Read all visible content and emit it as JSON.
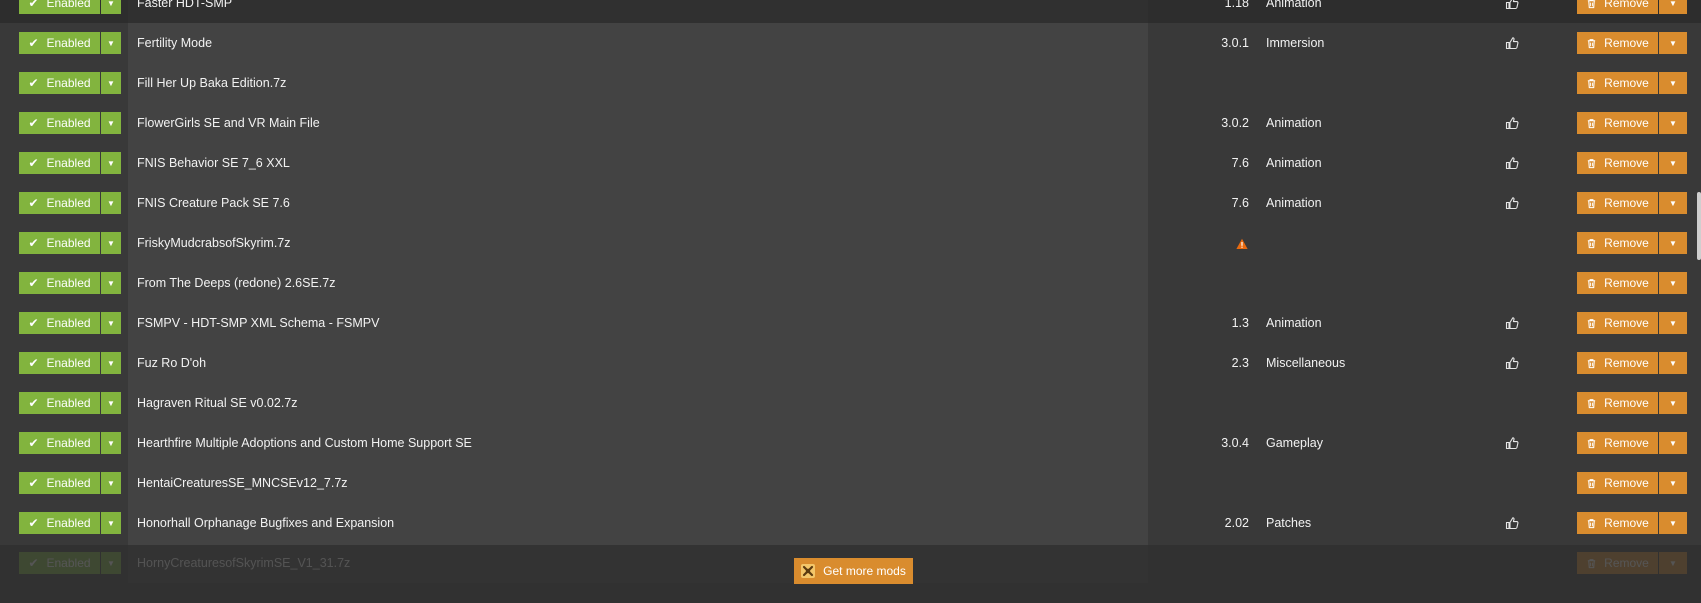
{
  "labels": {
    "enabled": "Enabled",
    "remove": "Remove",
    "get_more": "Get more mods"
  },
  "colors": {
    "enabled_green": "#82b43e",
    "remove_orange": "#d98c2e",
    "warning": "#e86a10"
  },
  "mods": [
    {
      "name": "Faster HDT-SMP",
      "version": "1.18",
      "category": "Animation",
      "endorse": true,
      "warning": false
    },
    {
      "name": "Fertility Mode",
      "version": "3.0.1",
      "category": "Immersion",
      "endorse": true,
      "warning": false
    },
    {
      "name": "Fill Her Up Baka Edition.7z",
      "version": "",
      "category": "",
      "endorse": false,
      "warning": false
    },
    {
      "name": "FlowerGirls SE and VR Main File",
      "version": "3.0.2",
      "category": "Animation",
      "endorse": true,
      "warning": false
    },
    {
      "name": "FNIS Behavior SE 7_6 XXL",
      "version": "7.6",
      "category": "Animation",
      "endorse": true,
      "warning": false
    },
    {
      "name": "FNIS Creature Pack SE 7.6",
      "version": "7.6",
      "category": "Animation",
      "endorse": true,
      "warning": false
    },
    {
      "name": "FriskyMudcrabsofSkyrim.7z",
      "version": "",
      "category": "",
      "endorse": false,
      "warning": true
    },
    {
      "name": "From The Deeps (redone) 2.6SE.7z",
      "version": "",
      "category": "",
      "endorse": false,
      "warning": false
    },
    {
      "name": "FSMPV - HDT-SMP XML Schema - FSMPV",
      "version": "1.3",
      "category": "Animation",
      "endorse": true,
      "warning": false
    },
    {
      "name": "Fuz Ro D'oh",
      "version": "2.3",
      "category": "Miscellaneous",
      "endorse": true,
      "warning": false
    },
    {
      "name": "Hagraven Ritual SE v0.02.7z",
      "version": "",
      "category": "",
      "endorse": false,
      "warning": false
    },
    {
      "name": "Hearthfire Multiple Adoptions and Custom Home Support SE",
      "version": "3.0.4",
      "category": "Gameplay",
      "endorse": true,
      "warning": false
    },
    {
      "name": "HentaiCreaturesSE_MNCSEv12_7.7z",
      "version": "",
      "category": "",
      "endorse": false,
      "warning": false
    },
    {
      "name": "Honorhall Orphanage Bugfixes and Expansion",
      "version": "2.02",
      "category": "Patches",
      "endorse": true,
      "warning": false
    },
    {
      "name": "HornyCreaturesofSkyrimSE_V1_31.7z",
      "version": "",
      "category": "",
      "endorse": false,
      "warning": false
    }
  ]
}
